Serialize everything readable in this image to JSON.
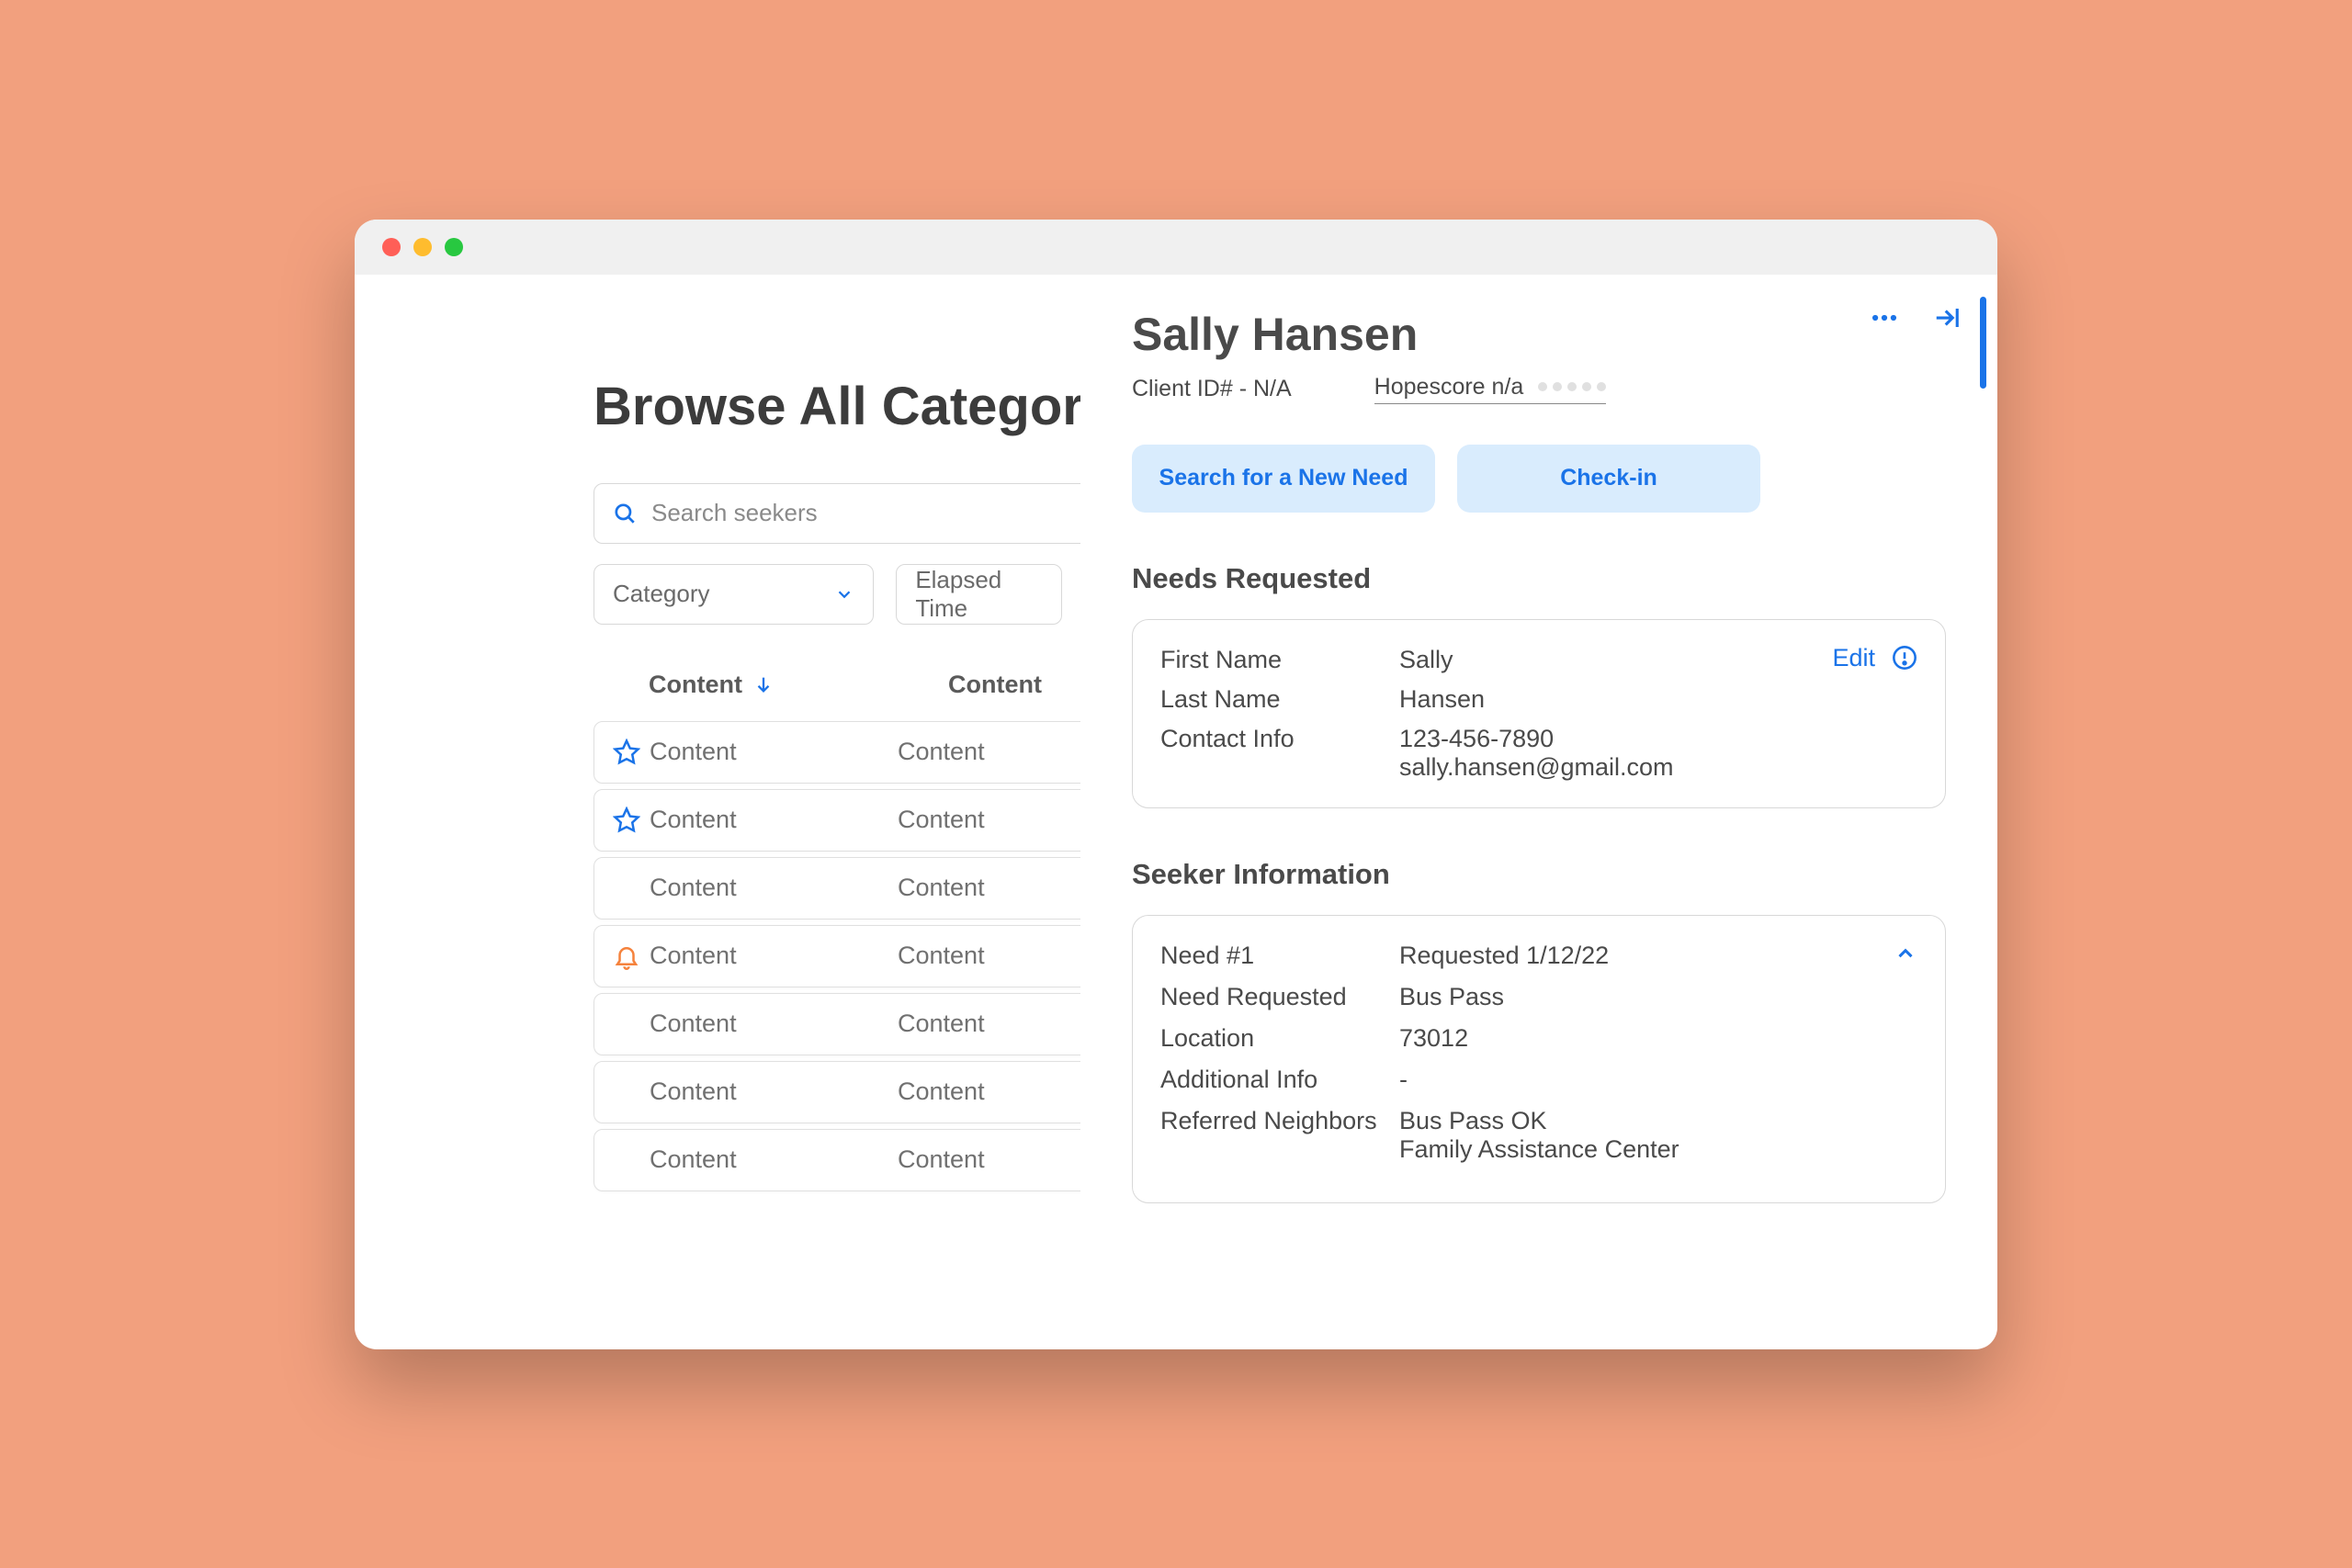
{
  "left": {
    "title": "Browse All Categories",
    "search_placeholder": "Search seekers",
    "filter_category": "Category",
    "filter_time": "Elapsed Time",
    "col1": "Content",
    "col2": "Content",
    "rows": [
      {
        "icon": "star",
        "c1": "Content",
        "c2": "Content"
      },
      {
        "icon": "star",
        "c1": "Content",
        "c2": "Content"
      },
      {
        "icon": "",
        "c1": "Content",
        "c2": "Content"
      },
      {
        "icon": "bell",
        "c1": "Content",
        "c2": "Content"
      },
      {
        "icon": "",
        "c1": "Content",
        "c2": "Content"
      },
      {
        "icon": "",
        "c1": "Content",
        "c2": "Content"
      },
      {
        "icon": "",
        "c1": "Content",
        "c2": "Content"
      }
    ]
  },
  "right": {
    "name": "Sally Hansen",
    "client_id": "Client ID# - N/A",
    "hopescore": "Hopescore n/a",
    "btn_search": "Search for a New Need",
    "btn_checkin": "Check-in",
    "needs_title": "Needs Requested",
    "edit": "Edit",
    "info": {
      "first_label": "First Name",
      "first_value": "Sally",
      "last_label": "Last Name",
      "last_value": "Hansen",
      "contact_label": "Contact Info",
      "phone": "123-456-7890",
      "email": "sally.hansen@gmail.com"
    },
    "seeker_title": "Seeker Information",
    "seeker": {
      "need_num_label": "Need #1",
      "need_num_value": "Requested 1/12/22",
      "need_req_label": "Need Requested",
      "need_req_value": "Bus Pass",
      "loc_label": "Location",
      "loc_value": "73012",
      "addl_label": "Additional Info",
      "addl_value": "-",
      "ref_label": "Referred Neighbors",
      "ref1": "Bus Pass OK",
      "ref2": "Family Assistance Center"
    }
  }
}
